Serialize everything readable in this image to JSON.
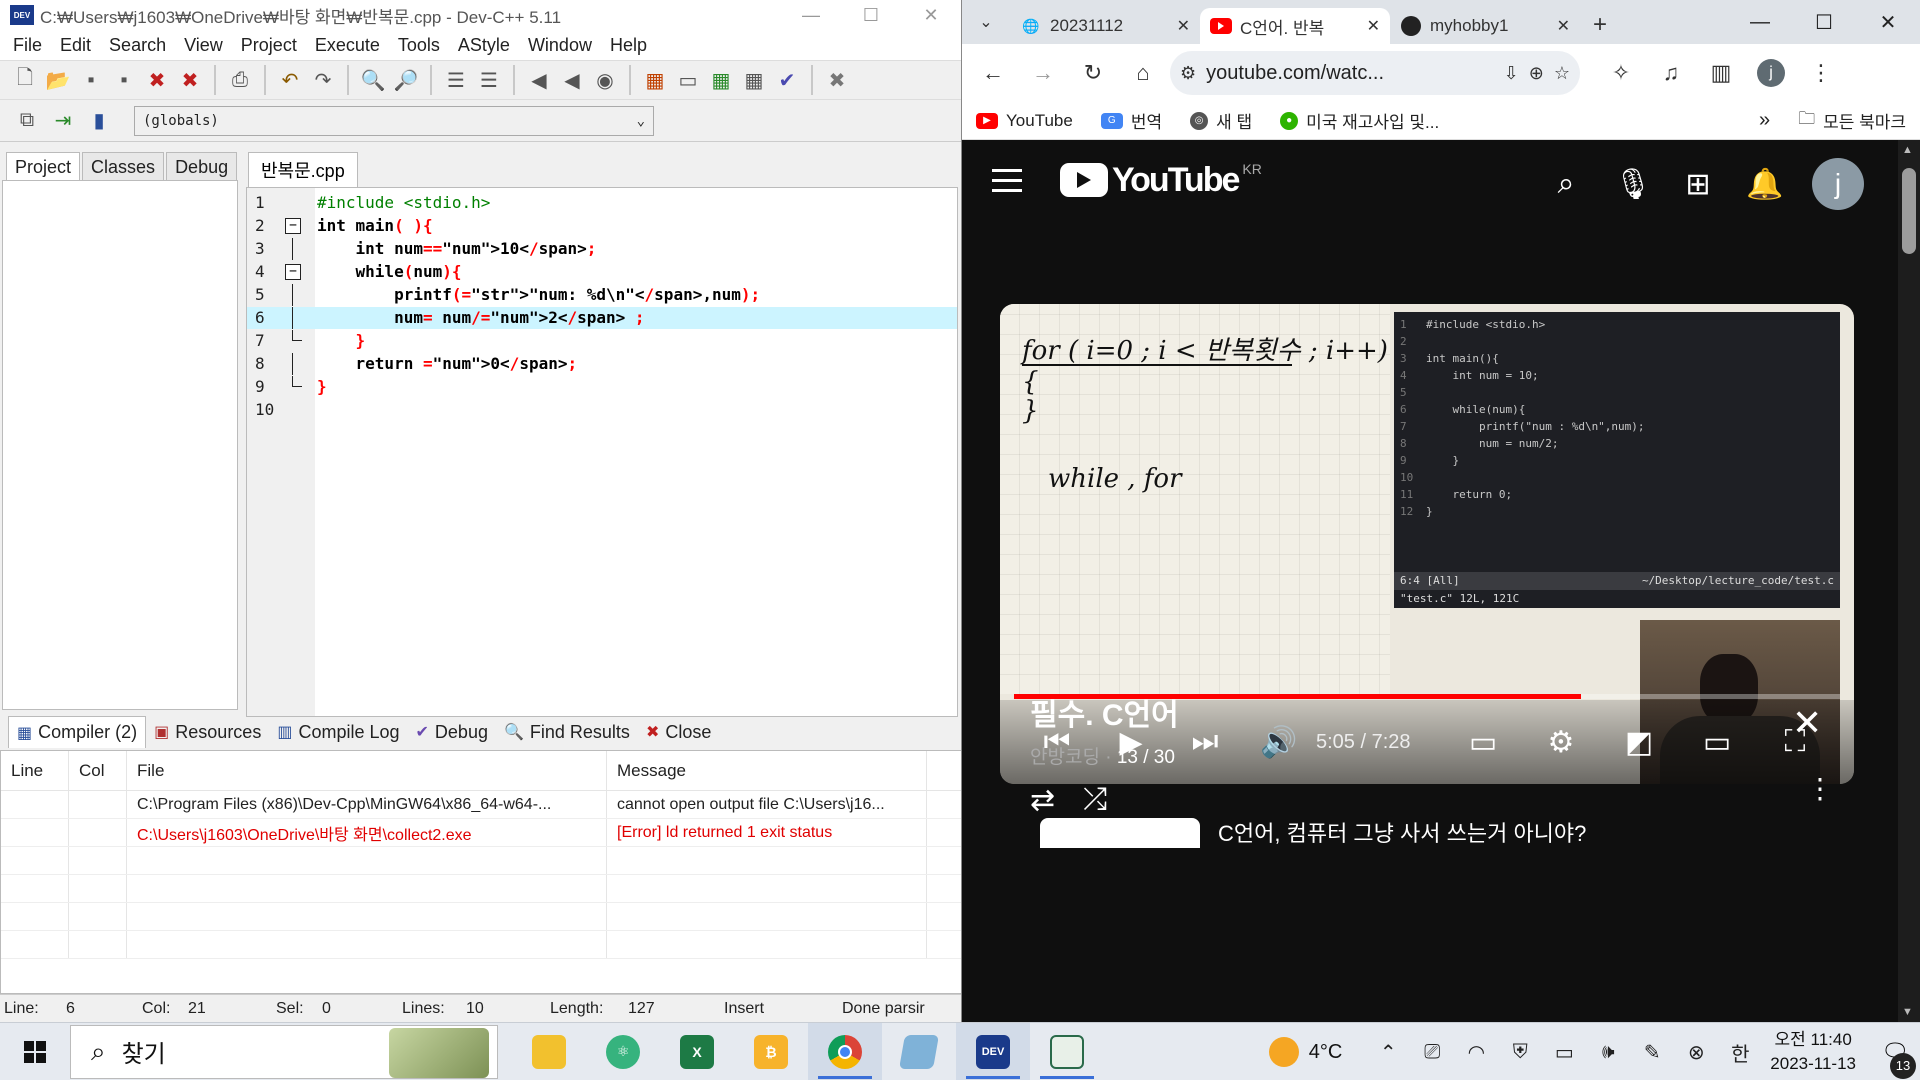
{
  "devcpp": {
    "title": "C:₩Users₩j1603₩OneDrive₩바탕 화면₩반복문.cpp - Dev-C++ 5.11",
    "app_icon": "DEV",
    "menu": [
      "File",
      "Edit",
      "Search",
      "View",
      "Project",
      "Execute",
      "Tools",
      "AStyle",
      "Window",
      "Help"
    ],
    "globals": "(globals)",
    "left_tabs": [
      "Project",
      "Classes",
      "Debug"
    ],
    "editor_tab": "반복문.cpp",
    "code_lines": [
      {
        "n": "1",
        "text": "#include <stdio.h>"
      },
      {
        "n": "2",
        "text": "int main( ){"
      },
      {
        "n": "3",
        "text": "    int num=10;"
      },
      {
        "n": "4",
        "text": "    while(num){"
      },
      {
        "n": "5",
        "text": "        printf(\"num: %d\\n\",num);"
      },
      {
        "n": "6",
        "text": "        num= num/2 ;"
      },
      {
        "n": "7",
        "text": "    }"
      },
      {
        "n": "8",
        "text": "    return 0;"
      },
      {
        "n": "9",
        "text": "}"
      },
      {
        "n": "10",
        "text": ""
      }
    ],
    "highlighted_line": "6",
    "bottom_tabs": [
      {
        "label": "Compiler (2)",
        "icon": "grid-icon"
      },
      {
        "label": "Resources",
        "icon": "resources-icon"
      },
      {
        "label": "Compile Log",
        "icon": "chart-icon"
      },
      {
        "label": "Debug",
        "icon": "check-icon"
      },
      {
        "label": "Find Results",
        "icon": "find-icon"
      },
      {
        "label": "Close",
        "icon": "close-icon"
      }
    ],
    "results_headers": [
      "Line",
      "Col",
      "File",
      "Message"
    ],
    "results_rows": [
      {
        "line": "",
        "col": "",
        "file": "C:\\Program Files (x86)\\Dev-Cpp\\MinGW64\\x86_64-w64-...",
        "message": "cannot open output file C:\\Users\\j16...",
        "error": false
      },
      {
        "line": "",
        "col": "",
        "file": "C:\\Users\\j1603\\OneDrive\\바탕 화면\\collect2.exe",
        "message": "[Error] ld returned 1 exit status",
        "error": true
      }
    ],
    "status": {
      "line_label": "Line:",
      "line": "6",
      "col_label": "Col:",
      "col": "21",
      "sel_label": "Sel:",
      "sel": "0",
      "lines_label": "Lines:",
      "lines": "10",
      "length_label": "Length:",
      "length": "127",
      "mode": "Insert",
      "parse": "Done parsir"
    }
  },
  "chrome": {
    "tabs": [
      {
        "title": "20231112",
        "icon": "globe-icon"
      },
      {
        "title": "C언어. 반복",
        "icon": "youtube-icon"
      },
      {
        "title": "myhobby1",
        "icon": "github-icon"
      }
    ],
    "url": "youtube.com/watc...",
    "avatar_letter": "j",
    "bookmarks": [
      {
        "label": "YouTube",
        "color": "#ff0000"
      },
      {
        "label": "번역",
        "color": "#4285f4"
      },
      {
        "label": "새 탭",
        "color": "#555555"
      },
      {
        "label": "미국 재고사입 및...",
        "color": "#2db400"
      }
    ],
    "all_bookmarks": "모든 북마크"
  },
  "youtube": {
    "logo_text": "YouTube",
    "region": "KR",
    "avatar_letter": "j",
    "video": {
      "whiteboard_line1": "for ( i=0 ; i < 반복횟수 ; i++){",
      "whiteboard_line2": "}",
      "whiteboard_line3": "while , for",
      "terminal_lines": [
        {
          "n": "1",
          "t": "#include <stdio.h>"
        },
        {
          "n": "2",
          "t": ""
        },
        {
          "n": "3",
          "t": "int main(){"
        },
        {
          "n": "4",
          "t": "    int num = 10;"
        },
        {
          "n": "5",
          "t": ""
        },
        {
          "n": "6",
          "t": "    while(num){"
        },
        {
          "n": "7",
          "t": "        printf(\"num : %d\\n\",num);"
        },
        {
          "n": "8",
          "t": "        num = num/2;"
        },
        {
          "n": "9",
          "t": "    }"
        },
        {
          "n": "10",
          "t": ""
        },
        {
          "n": "11",
          "t": "    return 0;"
        },
        {
          "n": "12",
          "t": "}"
        }
      ],
      "term_status_left": "6:4 [All]",
      "term_status_right": "~/Desktop/lecture_code/test.c",
      "term_status2": "\"test.c\" 12L, 121C",
      "time": "5:05 / 7:28",
      "progress": 0.687
    },
    "playlist": {
      "title": "필수. C언어",
      "channel": "안방코딩",
      "position": "13 / 30",
      "next_title": "C언어, 컴퓨터 그냥 사서 쓰는거 아니야?"
    }
  },
  "taskbar": {
    "search_placeholder": "찾기",
    "weather": "4°C",
    "time": "오전 11:40",
    "date": "2023-11-13",
    "ime": "한",
    "notification_count": "13"
  }
}
